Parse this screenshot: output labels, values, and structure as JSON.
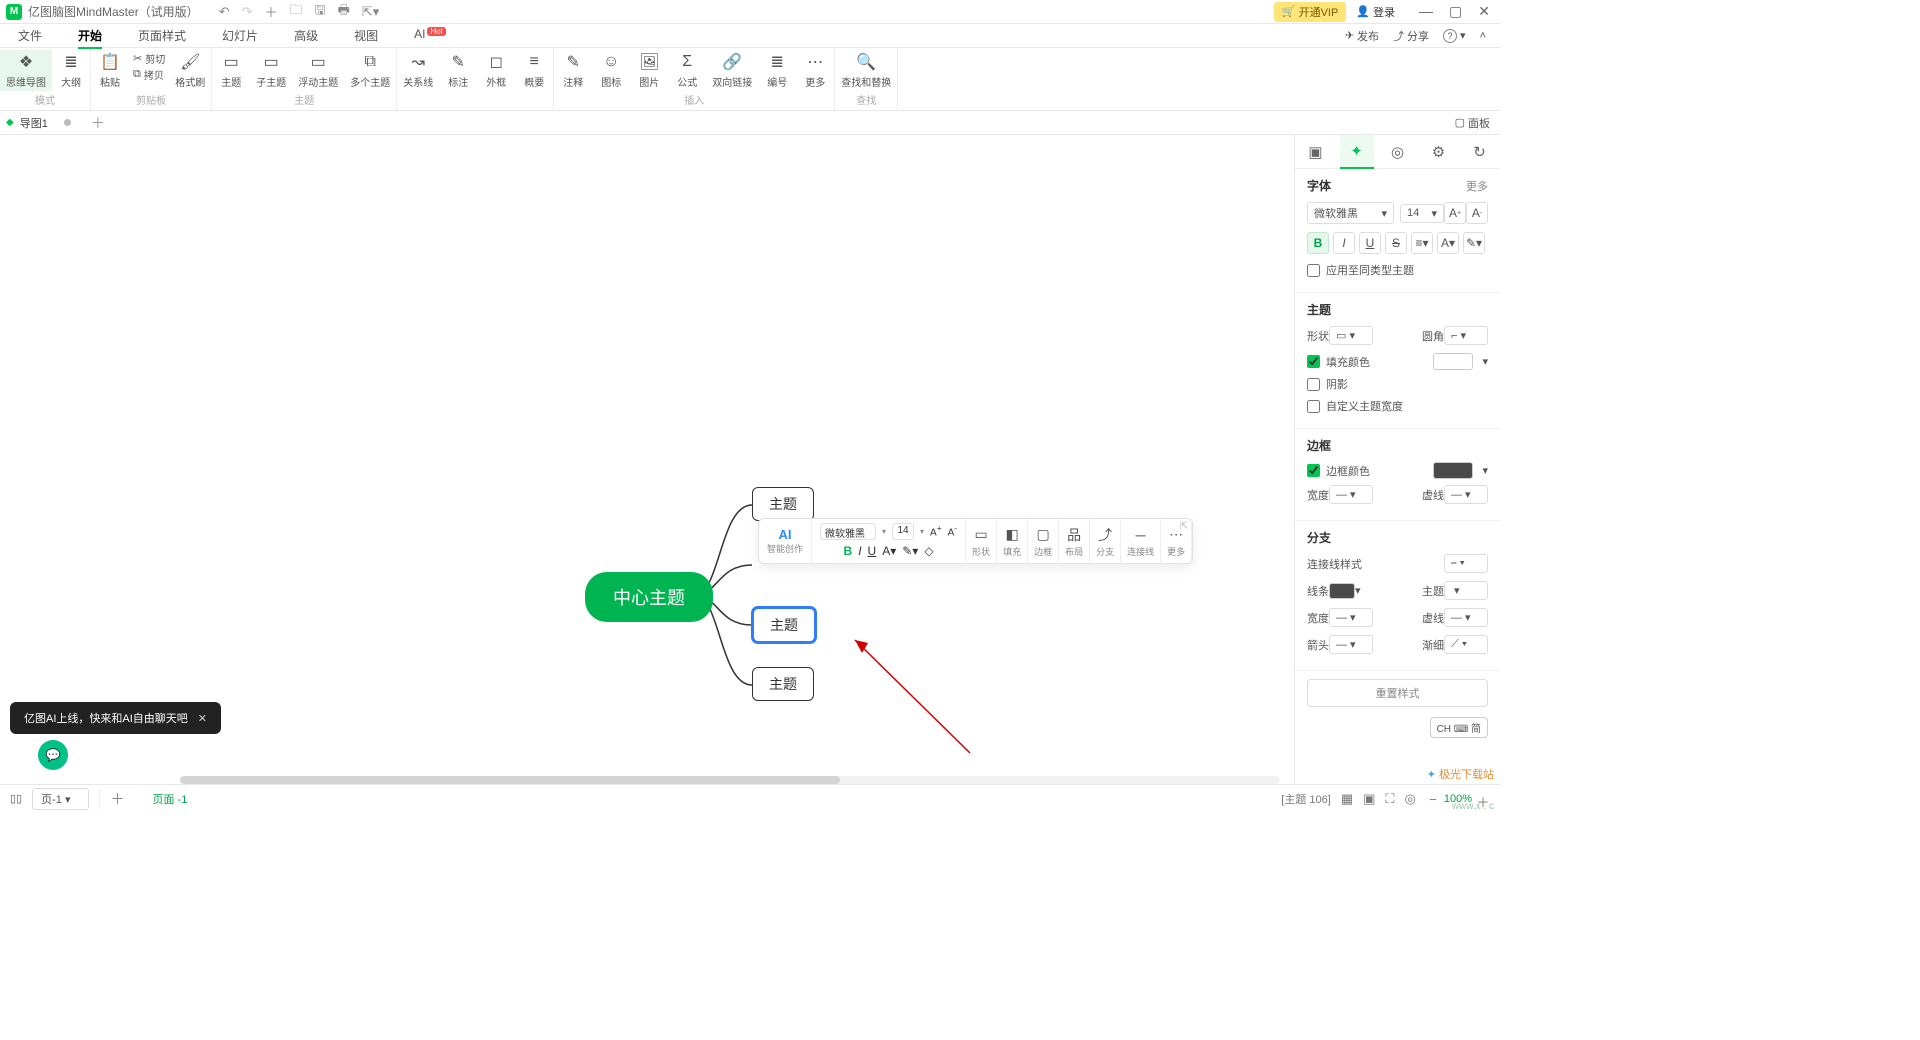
{
  "titlebar": {
    "app_name": "亿图脑图MindMaster（试用版）",
    "vip": "开通VIP",
    "login": "登录"
  },
  "menubar": {
    "tabs": [
      "文件",
      "开始",
      "页面样式",
      "幻灯片",
      "高级",
      "视图",
      "AI"
    ],
    "active_index": 1,
    "hot": "Hot",
    "right": {
      "publish": "发布",
      "share": "分享"
    }
  },
  "ribbon": {
    "groups": [
      {
        "label": "模式",
        "items": [
          {
            "name": "mindmap",
            "label": "思维导图",
            "icon": "❖",
            "active": true
          },
          {
            "name": "outline",
            "label": "大纲",
            "icon": "≣"
          }
        ]
      },
      {
        "label": "剪贴板",
        "items_split": [
          {
            "name": "paste",
            "label": "粘贴",
            "icon": "📋"
          }
        ],
        "mini": [
          {
            "name": "cut",
            "label": "剪切",
            "icon": "✂"
          },
          {
            "name": "copy",
            "label": "拷贝",
            "icon": "⧉"
          }
        ],
        "tail": [
          {
            "name": "format-painter",
            "label": "格式刷",
            "icon": "🖌"
          }
        ]
      },
      {
        "label": "主题",
        "items": [
          {
            "name": "topic",
            "label": "主题",
            "icon": "▭"
          },
          {
            "name": "subtopic",
            "label": "子主题",
            "icon": "▭"
          },
          {
            "name": "floating-topic",
            "label": "浮动主题",
            "icon": "▭"
          },
          {
            "name": "multi-topic",
            "label": "多个主题",
            "icon": "⧉"
          }
        ]
      },
      {
        "label": "",
        "items": [
          {
            "name": "relation",
            "label": "关系线",
            "icon": "↝"
          },
          {
            "name": "callout",
            "label": "标注",
            "icon": "✎"
          },
          {
            "name": "boundary",
            "label": "外框",
            "icon": "◻"
          },
          {
            "name": "summary",
            "label": "概要",
            "icon": "≡"
          }
        ]
      },
      {
        "label": "插入",
        "items": [
          {
            "name": "note",
            "label": "注释",
            "icon": "✎"
          },
          {
            "name": "icon",
            "label": "图标",
            "icon": "☺"
          },
          {
            "name": "image",
            "label": "图片",
            "icon": "🖼"
          },
          {
            "name": "formula",
            "label": "公式",
            "icon": "Σ"
          },
          {
            "name": "hyperlink",
            "label": "双向链接",
            "icon": "🔗"
          },
          {
            "name": "numbering",
            "label": "编号",
            "icon": "≣"
          },
          {
            "name": "more",
            "label": "更多",
            "icon": "⋯"
          }
        ]
      },
      {
        "label": "查找",
        "items": [
          {
            "name": "find-replace",
            "label": "查找和替换",
            "icon": "🔍"
          }
        ]
      }
    ]
  },
  "tabstrip": {
    "doc_name": "导图1",
    "panel": "面板"
  },
  "mindmap": {
    "central": "中心主题",
    "topics": [
      "主题",
      "主题",
      "主题",
      "主题"
    ],
    "selected_index": 2
  },
  "float_toolbar": {
    "ai": "AI",
    "ai_sub": "智能创作",
    "font": "微软雅黑",
    "size": "14",
    "cols": [
      {
        "name": "shape",
        "label": "形状",
        "icon": "▭"
      },
      {
        "name": "fill",
        "label": "填充",
        "icon": "◧"
      },
      {
        "name": "border",
        "label": "边框",
        "icon": "▢"
      },
      {
        "name": "layout",
        "label": "布局",
        "icon": "品"
      },
      {
        "name": "branch",
        "label": "分支",
        "icon": "⤴"
      },
      {
        "name": "connector",
        "label": "连接线",
        "icon": "─"
      },
      {
        "name": "more",
        "label": "更多",
        "icon": "⋯"
      }
    ]
  },
  "ai_toast": "亿图AI上线，快来和AI自由聊天吧",
  "right_panel": {
    "font": {
      "title": "字体",
      "more": "更多",
      "family": "微软雅黑",
      "size": "14",
      "apply_same": "应用至同类型主题"
    },
    "topic": {
      "title": "主题",
      "shape": "形状",
      "corner": "圆角",
      "fill": "填充颜色",
      "shadow": "阴影",
      "custom_width": "自定义主题宽度"
    },
    "border": {
      "title": "边框",
      "color": "边框颜色",
      "width": "宽度",
      "dash": "虚线",
      "color_val": "#4a4a4a"
    },
    "branch": {
      "title": "分支",
      "connector": "连接线样式",
      "line": "线条",
      "topic": "主题",
      "width": "宽度",
      "dash": "虚线",
      "arrow": "箭头",
      "taper": "渐细",
      "line_color": "#4a4a4a"
    },
    "reset": "重置样式"
  },
  "ime": "CH ⌨ 简",
  "pager": {
    "page_sel": "页-1",
    "breadcrumb": "页面 -1",
    "topic_count": "[主题 106]",
    "zoom": "100%"
  },
  "watermark": {
    "site": "www.x . c",
    "brand": "极光下载站"
  }
}
